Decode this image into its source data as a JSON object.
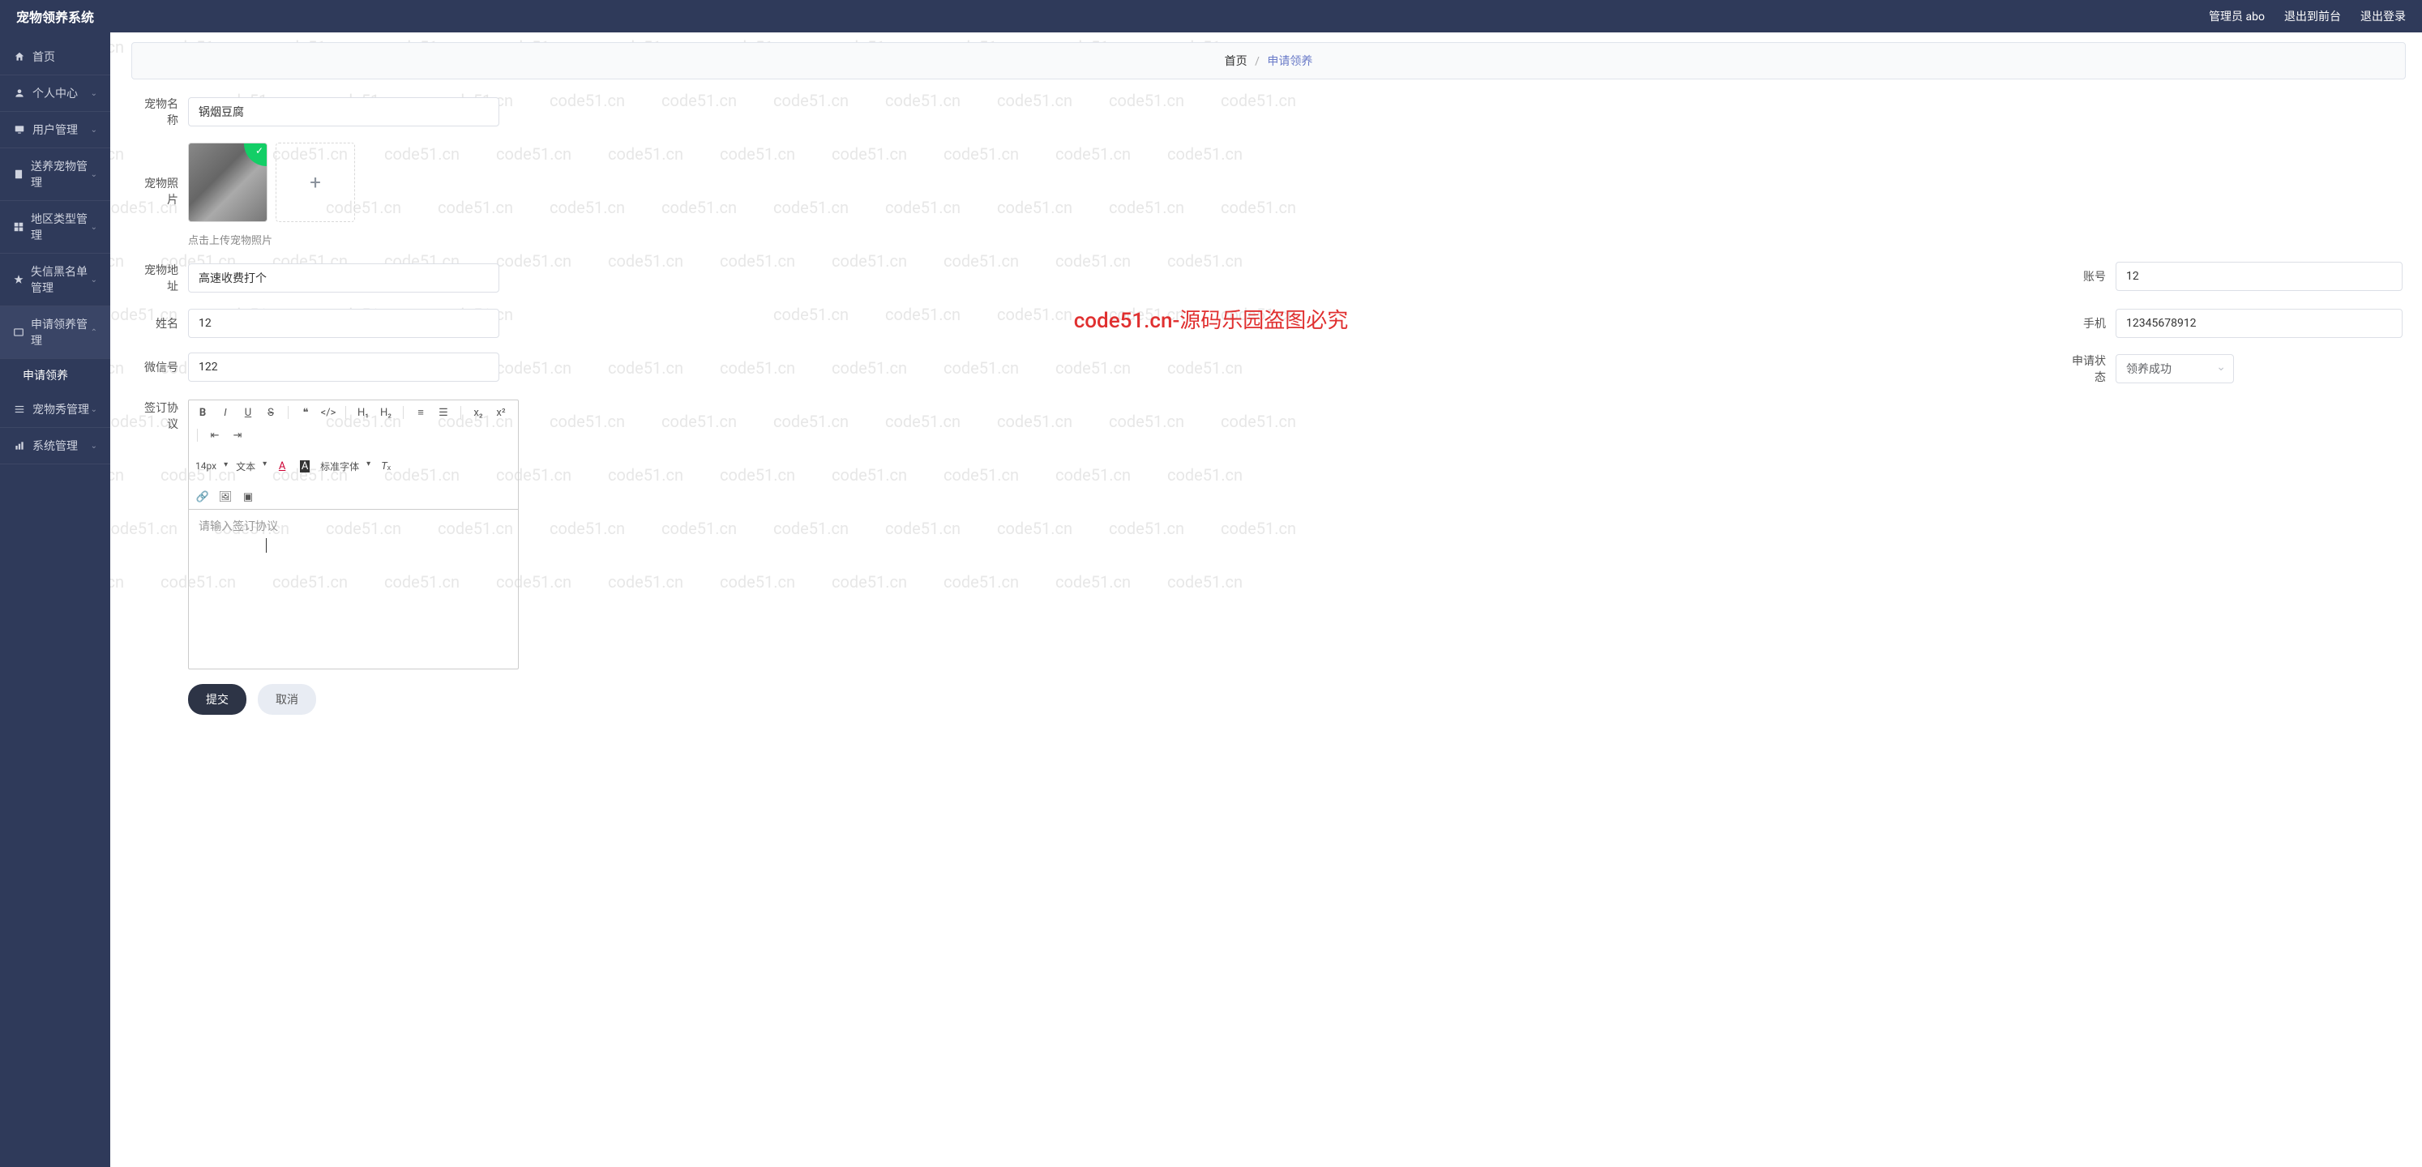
{
  "app": {
    "title": "宠物领养系统"
  },
  "header": {
    "admin": "管理员 abo",
    "logout_front": "退出到前台",
    "logout": "退出登录"
  },
  "sidebar": {
    "items": [
      {
        "icon": "home",
        "label": "首页",
        "arrow": false
      },
      {
        "icon": "user",
        "label": "个人中心",
        "arrow": true
      },
      {
        "icon": "screen",
        "label": "用户管理",
        "arrow": true
      },
      {
        "icon": "doc",
        "label": "送养宠物管理",
        "arrow": true
      },
      {
        "icon": "grid",
        "label": "地区类型管理",
        "arrow": true
      },
      {
        "icon": "star",
        "label": "失信黑名单管理",
        "arrow": true
      },
      {
        "icon": "tab",
        "label": "申请领养管理",
        "arrow": true,
        "expanded": true
      },
      {
        "icon": "list",
        "label": "宠物秀管理",
        "arrow": true
      },
      {
        "icon": "chart",
        "label": "系统管理",
        "arrow": true
      }
    ],
    "sub_apply": "申请领养"
  },
  "breadcrumb": {
    "home": "首页",
    "sep": "/",
    "current": "申请领养"
  },
  "form": {
    "pet_name": {
      "label": "宠物名称",
      "value": "锅烟豆腐"
    },
    "pet_photo": {
      "label": "宠物照片",
      "hint": "点击上传宠物照片"
    },
    "pet_address": {
      "label": "宠物地址",
      "value": "高速收费打个"
    },
    "account": {
      "label": "账号",
      "value": "12"
    },
    "name": {
      "label": "姓名",
      "value": "12"
    },
    "phone": {
      "label": "手机",
      "value": "12345678912"
    },
    "wechat": {
      "label": "微信号",
      "value": "122"
    },
    "status": {
      "label": "申请状态",
      "value": "领养成功"
    },
    "agreement": {
      "label": "签订协议",
      "placeholder": "请输入签订协议"
    }
  },
  "editor_selects": {
    "size": "14px",
    "type": "文本",
    "font": "标准字体"
  },
  "buttons": {
    "submit": "提交",
    "cancel": "取消"
  },
  "watermark": "code51.cn",
  "wm_center": "code51.cn-源码乐园盗图必究"
}
